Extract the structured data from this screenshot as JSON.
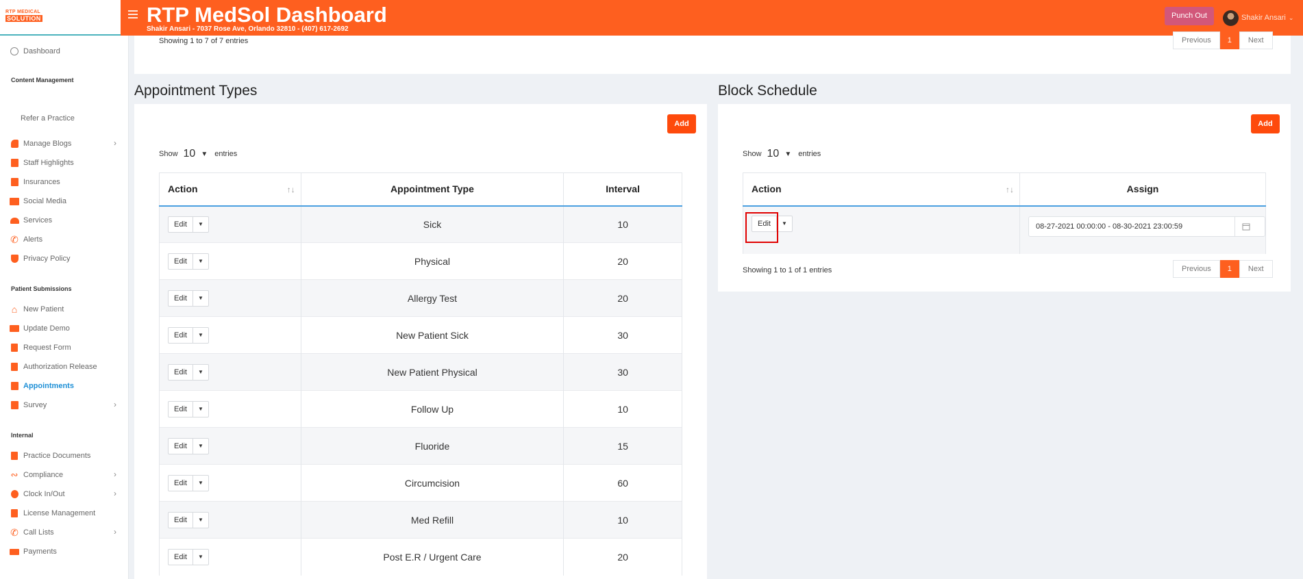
{
  "header": {
    "logo_line1": "RTP MEDICAL",
    "logo_line2": "SOLUTION",
    "title": "RTP MedSol Dashboard",
    "subtitle": "Shakir Ansari - 7037 Rose Ave, Orlando 32810 - (407) 617-2692",
    "punch_label": "Punch Out",
    "user_name": "Shakir Ansari",
    "accent": "#fe5f1f"
  },
  "sidebar": {
    "dashboard": "Dashboard",
    "section_content": "Content Management",
    "refer": "Refer a Practice",
    "manage_blogs": "Manage Blogs",
    "staff_highlights": "Staff Highlights",
    "insurances": "Insurances",
    "social_media": "Social Media",
    "services": "Services",
    "alerts": "Alerts",
    "privacy_policy": "Privacy Policy",
    "section_patient": "Patient Submissions",
    "new_patient": "New Patient",
    "update_demo": "Update Demo",
    "request_form": "Request Form",
    "authorization_release": "Authorization Release",
    "appointments": "Appointments",
    "survey": "Survey",
    "section_internal": "Internal",
    "practice_documents": "Practice Documents",
    "compliance": "Compliance",
    "clock_in_out": "Clock In/Out",
    "license_management": "License Management",
    "call_lists": "Call Lists",
    "payments": "Payments"
  },
  "top_card": {
    "info": "Showing 1 to 7 of 7 entries",
    "prev": "Previous",
    "page": "1",
    "next": "Next"
  },
  "appointment_types": {
    "title": "Appointment Types",
    "add": "Add",
    "show_label": "Show",
    "entries_value": "10",
    "entries_label": "entries",
    "col_action": "Action",
    "col_type": "Appointment Type",
    "col_interval": "Interval",
    "edit_label": "Edit",
    "rows": [
      {
        "type": "Sick",
        "interval": "10"
      },
      {
        "type": "Physical",
        "interval": "20"
      },
      {
        "type": "Allergy Test",
        "interval": "20"
      },
      {
        "type": "New Patient Sick",
        "interval": "30"
      },
      {
        "type": "New Patient Physical",
        "interval": "30"
      },
      {
        "type": "Follow Up",
        "interval": "10"
      },
      {
        "type": "Fluoride",
        "interval": "15"
      },
      {
        "type": "Circumcision",
        "interval": "60"
      },
      {
        "type": "Med Refill",
        "interval": "10"
      },
      {
        "type": "Post E.R / Urgent Care",
        "interval": "20"
      }
    ]
  },
  "block_schedule": {
    "title": "Block Schedule",
    "add": "Add",
    "show_label": "Show",
    "entries_value": "10",
    "entries_label": "entries",
    "col_action": "Action",
    "col_assign": "Assign",
    "edit_label": "Edit",
    "assign_value": "08-27-2021 00:00:00 - 08-30-2021 23:00:59",
    "info": "Showing 1 to 1 of 1 entries",
    "prev": "Previous",
    "page": "1",
    "next": "Next"
  }
}
